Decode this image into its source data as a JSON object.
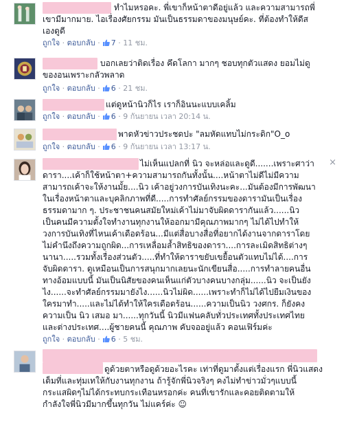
{
  "labels": {
    "like": "ถูกใจ",
    "reply": "ตอบกลับ",
    "close": "×"
  },
  "comments": [
    {
      "text": "ทำไมหรอคะ. พี่เขาก็หน้าตาดีอยู่แล้ว และความสามารถพี่\nเขามีมากมาย. ไอเรื่องศัยกรรม มันเป็นธรรมดาของมนุษย์คะ. ที่ต้องทำให้ดีส\nเองดูดี",
      "likes": "7",
      "time": "11 ชม."
    },
    {
      "text": "บอกเลยว่าติดเรื่อง คึดโลกา มากๆ ชอบทุกตัวแสดง ยอมไม่ดู\nของอนเพราะกลัวพลาด",
      "likes": "6",
      "time": "21 ชม."
    },
    {
      "text": "แต่ดูหน้านิวก็ไร เราก็อินนะแบบเคลิ้ม",
      "likes": "6",
      "time": "9 กันยายน เวลา 20:14 น."
    },
    {
      "text": "พาดหัวข่าวประชดปะ \"ลมหัดแทบไม่กระดิก\"O_o",
      "likes": "6",
      "time": "9 กันยายน เวลา 13:17 น."
    },
    {
      "text": "ไม่เห็นแปลกที่ นิว จะหล่อและดูดี.......เพราะศาว่า\nดารา....เค้าก็ใช้หน้าตา+ความสามารถกันทั้งนั้น....หน้าตาไม่ดีไม่มีความ\nสามารถเค้าจะให้งานมั้ย....นิว เค้าอยู่วงการบันเทิงนะคะ...มันต้องมีการพัฒนา\nในเรื่องหน้าตาและบุคลิกภาพที่ดี.....การทำศัลย์กรรมของดารามันเป็นเรื่อง\nธรรมดามาก ๆ. ประชาชนคนสมัยใหม่เค้าไม่มาจับผิดดารากันแล้ว......นิว\nเป็นคนมีความตั้งใจทำงานทุกงานให้ออกมามีคุณภาพมากๆ ไม่ได้ไปทำให้\nวงการบันเทิงที่ไหนเค้าเดือดร้อน...มีแต่สื่อบางสื่อที่อยากได้งานจากดาราโดย\nไม่คำนึงถึงความถูกผิด...การเหลื่อมล้ำสิทธิของดารา....การละเมิดสิทธิต่างๆ\nนานา.....รวมทั้งเรื่องส่วนตัว.....ที่ทำให้ดาราขยับเขยื้อนตัวแทบไม่ได้....การ\nจับผิดดารา. ดูเหมือนเป็นการสนุกมากเลยนะนักเขียนสื่อ.....การทำลายคนอื่น\nทางอ้อมแบบนี้ มันเป็นนิสัยของคนเห็นแก่ตัวบางคนบางกลุ่ม......นิว จะเป็นยัง\nไง......จะทำศัลย์กรรมมายังไง......นิวไม่ผิด......เพราะทำก็ไม่ได้ไปยืมเงินของ\nใครมาทำ.....และไม่ได้ทำให้ใครเดือดร้อน......ความเป็นนิว วงศกร. ก็ยังคง\nความเป็น นิว เสมอ มา......ทุกวันนี้ นิวมีแฟนคลับทั่วประเทศทั้งประเทศไทย\nและต่างประเทศ....ผู้ชายคนนี้ คุณภาพ คับจออยู่แล้ว คอนเฟิร์มค่ะ",
      "likes": "6",
      "time": "5 ชม."
    },
    {
      "text": "ดูด้วยตาหรือดูด้วยอะไรคะ เท่าที่ดูมาตั้งแต่เรื่องแรก พี่นิวแสดง\nเต็มที่และทุ่มเทให้กับงานทุกงาน ถ้ารู้จักพี่นิวจริงๆ คงไม่ทำข่าวมั่วๆแบบนี้\nกระแสผิดๆไม่ได้กระทบกระเทือนหรอกค่ะ คนที่เขารักและคอยติดตามให้\nกำลังใจพี่นิวมีมากขึ้นทุกวัน ไม่แคร์ค่ะ ☺"
    }
  ]
}
